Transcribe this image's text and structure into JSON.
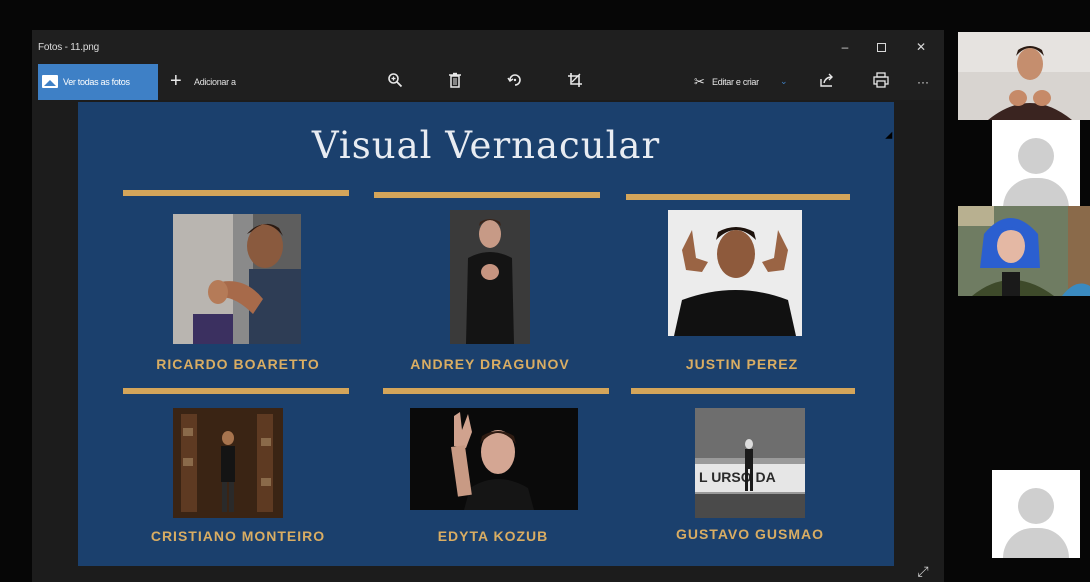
{
  "window": {
    "title": "Fotos - 11.png",
    "controls": {
      "minimize": "–",
      "close": "✕"
    }
  },
  "toolbar": {
    "view_all_label": "Ver todas as fotos",
    "add_label": "Adicionar a",
    "edit_create_label": "Editar e criar"
  },
  "slide": {
    "title": "Visual Vernacular",
    "accent_color": "#d4a55a",
    "background_color": "#1b406d",
    "performers": [
      {
        "name": "RICARDO BOARETTO"
      },
      {
        "name": "ANDREY DRAGUNOV"
      },
      {
        "name": "JUSTIN PEREZ"
      },
      {
        "name": "CRISTIANO MONTEIRO"
      },
      {
        "name": "EDYTA KOZUB"
      },
      {
        "name": "GUSTAVO GUSMAO"
      }
    ]
  },
  "icons": {
    "zoom": "zoom-in-icon",
    "delete": "delete-icon",
    "rotate": "rotate-icon",
    "crop": "crop-icon",
    "share": "share-icon",
    "print": "print-icon",
    "more": "more-icon",
    "expand": "expand-icon"
  },
  "video_call": {
    "participants": [
      {
        "type": "video"
      },
      {
        "type": "avatar"
      },
      {
        "type": "video"
      },
      {
        "type": "avatar"
      }
    ]
  }
}
